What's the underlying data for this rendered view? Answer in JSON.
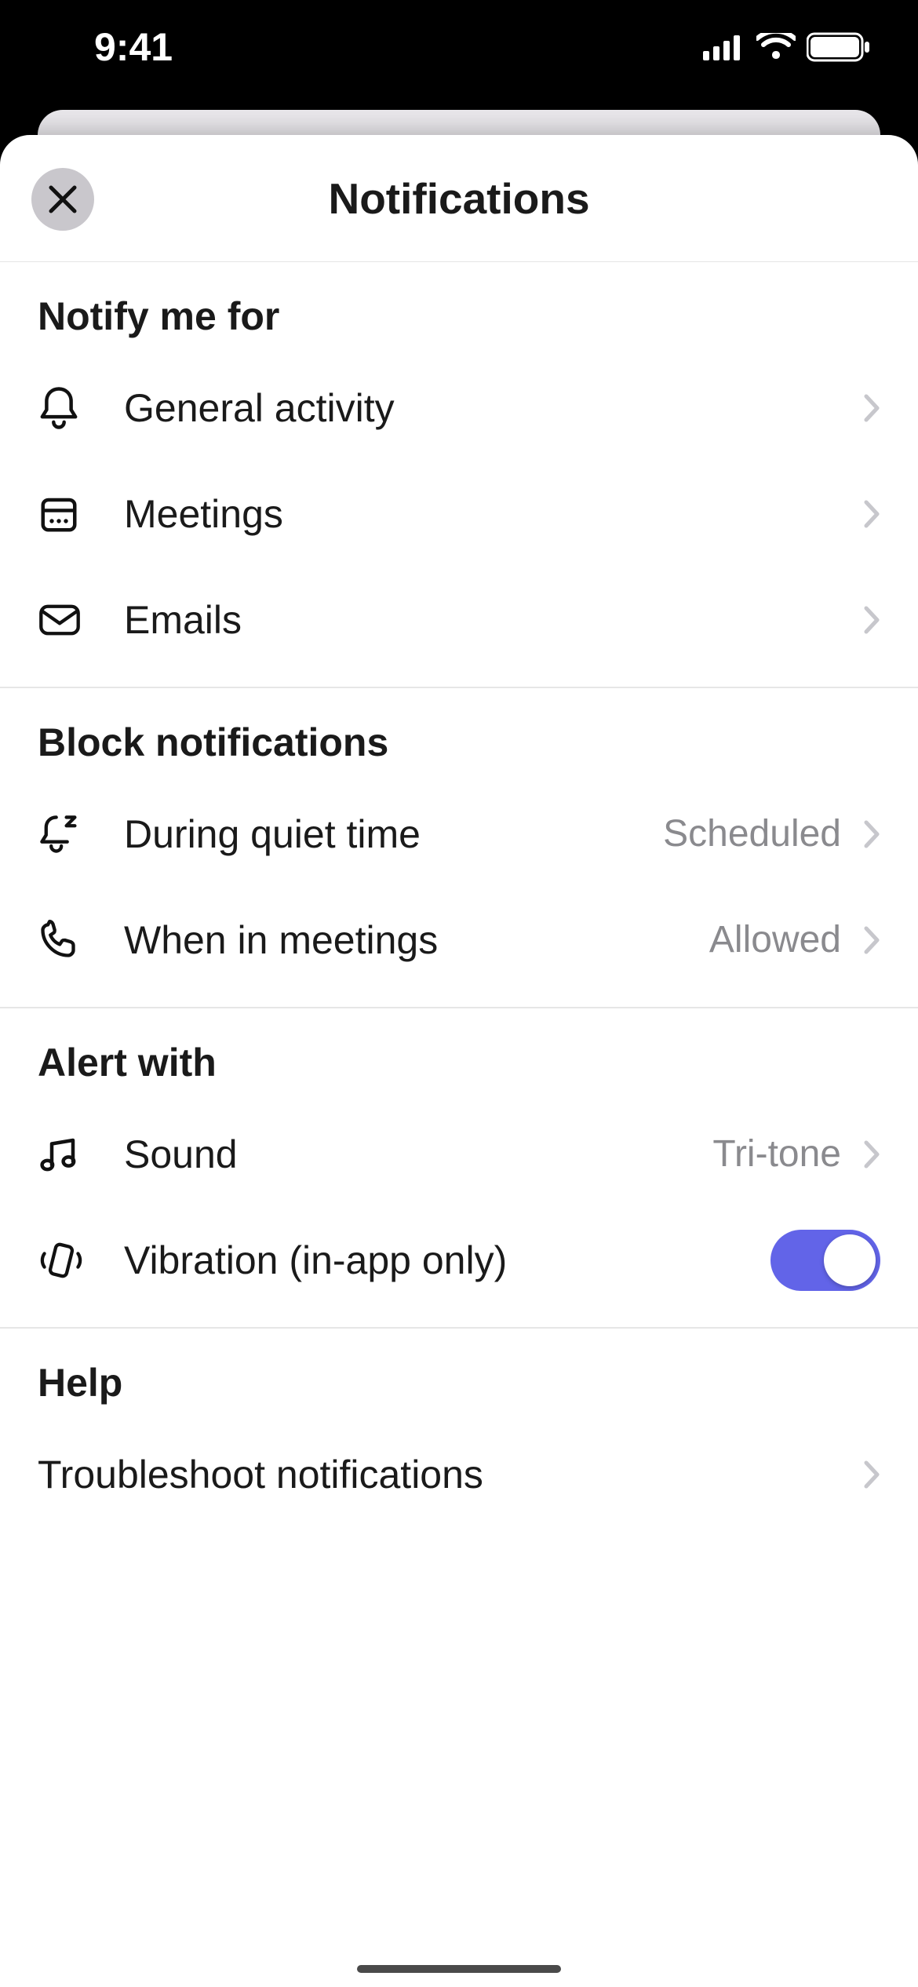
{
  "status": {
    "time": "9:41"
  },
  "sheet": {
    "title": "Notifications"
  },
  "sections": {
    "notify": {
      "header": "Notify me for",
      "items": {
        "general": {
          "label": "General activity"
        },
        "meetings": {
          "label": "Meetings"
        },
        "emails": {
          "label": "Emails"
        }
      }
    },
    "block": {
      "header": "Block notifications",
      "items": {
        "quiet": {
          "label": "During quiet time",
          "value": "Scheduled"
        },
        "in_meetings": {
          "label": "When in meetings",
          "value": "Allowed"
        }
      }
    },
    "alert": {
      "header": "Alert with",
      "items": {
        "sound": {
          "label": "Sound",
          "value": "Tri-tone"
        },
        "vibration": {
          "label": "Vibration (in-app only)",
          "enabled": true
        }
      }
    },
    "help": {
      "header": "Help",
      "items": {
        "troubleshoot": {
          "label": "Troubleshoot notifications"
        }
      }
    }
  }
}
